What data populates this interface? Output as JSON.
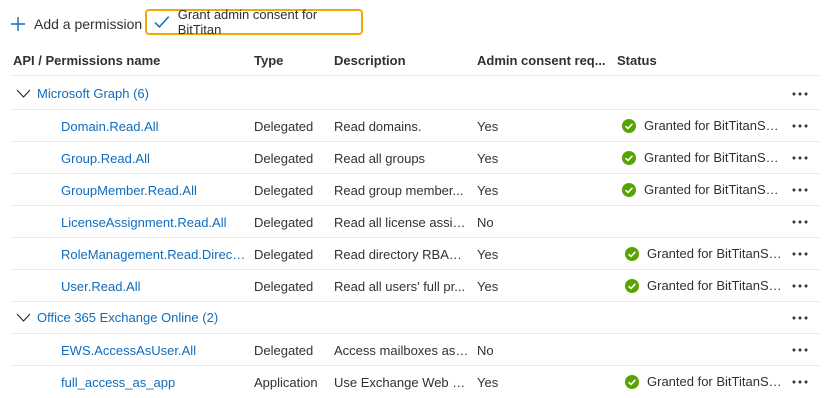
{
  "toolbar": {
    "add_permission_label": "Add a permission",
    "grant_consent_label": "Grant admin consent for BitTitan"
  },
  "columns": {
    "api": "API / Permissions name",
    "type": "Type",
    "description": "Description",
    "admin_consent": "Admin consent req...",
    "status": "Status"
  },
  "colors": {
    "link": "#0f6cbd",
    "highlight": "#f2a900",
    "success": "#57a300"
  },
  "groups": [
    {
      "label": "Microsoft Graph (6)",
      "permissions": [
        {
          "name": "Domain.Read.All",
          "type": "Delegated",
          "description": "Read domains.",
          "admin_consent": "Yes",
          "status": "Granted for BitTitanSup..."
        },
        {
          "name": "Group.Read.All",
          "type": "Delegated",
          "description": "Read all groups",
          "admin_consent": "Yes",
          "status": "Granted for BitTitanSup..."
        },
        {
          "name": "GroupMember.Read.All",
          "type": "Delegated",
          "description": "Read group member...",
          "admin_consent": "Yes",
          "status": "Granted for BitTitanSup..."
        },
        {
          "name": "LicenseAssignment.Read.All",
          "type": "Delegated",
          "description": "Read all license assig...",
          "admin_consent": "No",
          "status": ""
        },
        {
          "name": "RoleManagement.Read.Directory",
          "type": "Delegated",
          "description": "Read directory RBAC ...",
          "admin_consent": "Yes",
          "status": "Granted for BitTitanSup..."
        },
        {
          "name": "User.Read.All",
          "type": "Delegated",
          "description": "Read all users' full pr...",
          "admin_consent": "Yes",
          "status": "Granted for BitTitanSup..."
        }
      ]
    },
    {
      "label": "Office 365 Exchange Online (2)",
      "permissions": [
        {
          "name": "EWS.AccessAsUser.All",
          "type": "Delegated",
          "description": "Access mailboxes as t...",
          "admin_consent": "No",
          "status": ""
        },
        {
          "name": "full_access_as_app",
          "type": "Application",
          "description": "Use Exchange Web S...",
          "admin_consent": "Yes",
          "status": "Granted for BitTitanSup..."
        }
      ]
    }
  ]
}
